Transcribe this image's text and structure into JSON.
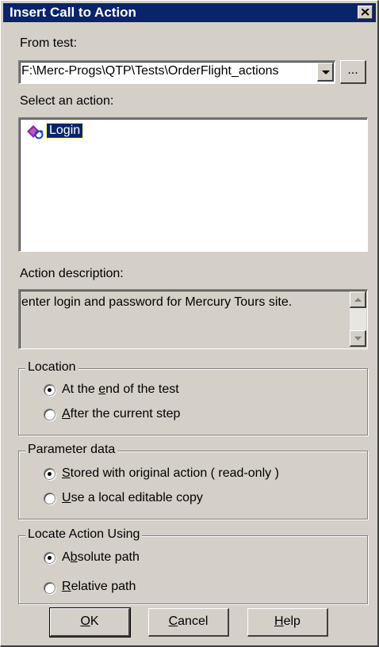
{
  "window": {
    "title": "Insert Call to Action"
  },
  "from_test": {
    "label": "From test:",
    "value": "F:\\Merc-Progs\\QTP\\Tests\\OrderFlight_actions",
    "browse_label": "..."
  },
  "select_action": {
    "label": "Select an action:",
    "items": [
      {
        "label": "Login",
        "icon": "action-icon",
        "selected": true
      }
    ]
  },
  "description": {
    "label": "Action description:",
    "text": "enter login and password for Mercury Tours site."
  },
  "location": {
    "title": "Location",
    "options": [
      {
        "pre": "At the ",
        "key": "e",
        "post": "nd of the test",
        "selected": true
      },
      {
        "pre": "",
        "key": "A",
        "post": "fter the current step",
        "selected": false
      }
    ]
  },
  "parameter_data": {
    "title": "Parameter data",
    "options": [
      {
        "pre": "",
        "key": "S",
        "post": "tored with original action ( read-only )",
        "selected": true
      },
      {
        "pre": "",
        "key": "U",
        "post": "se a local editable copy",
        "selected": false
      }
    ]
  },
  "locate_using": {
    "title": "Locate Action Using",
    "options": [
      {
        "pre": "A",
        "key": "b",
        "post": "solute path",
        "selected": true
      },
      {
        "pre": "",
        "key": "R",
        "post": "elative path",
        "selected": false
      }
    ]
  },
  "buttons": {
    "ok": {
      "key": "O",
      "post": "K"
    },
    "cancel": {
      "key": "C",
      "post": "ancel"
    },
    "help": {
      "key": "H",
      "post": "elp"
    }
  },
  "colors": {
    "face": "#d4d0c8",
    "title_bar": "#0a246a",
    "selection": "#0a246a"
  }
}
